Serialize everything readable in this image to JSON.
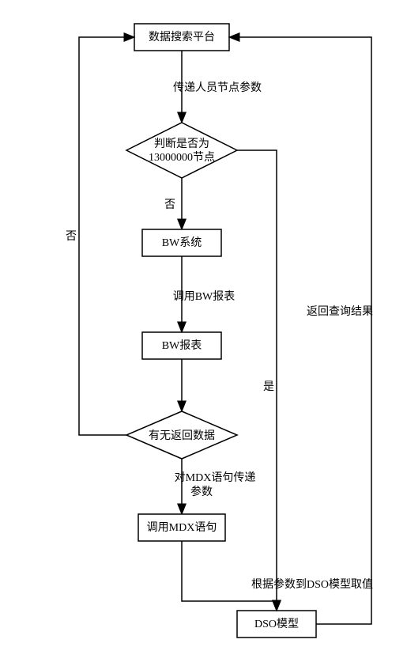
{
  "chart_data": {
    "type": "flowchart",
    "nodes": [
      {
        "id": "n1",
        "shape": "rect",
        "label": "数据搜索平台"
      },
      {
        "id": "n2",
        "shape": "diamond",
        "label_line1": "判断是否为",
        "label_line2": "13000000节点"
      },
      {
        "id": "n3",
        "shape": "rect",
        "label": "BW系统"
      },
      {
        "id": "n4",
        "shape": "rect",
        "label": "BW报表"
      },
      {
        "id": "n5",
        "shape": "diamond",
        "label": "有无返回数据"
      },
      {
        "id": "n6",
        "shape": "rect",
        "label": "调用MDX语句"
      },
      {
        "id": "n7",
        "shape": "rect",
        "label": "DSO模型"
      }
    ],
    "edges": [
      {
        "from": "n1",
        "to": "n2",
        "label": "传递人员节点参数"
      },
      {
        "from": "n2",
        "to": "n3",
        "label": "否"
      },
      {
        "from": "n3",
        "to": "n4",
        "label": "调用BW报表"
      },
      {
        "from": "n4",
        "to": "n5",
        "label": ""
      },
      {
        "from": "n5",
        "to": "n6",
        "label_line1": "对MDX语句传递",
        "label_line2": "参数"
      },
      {
        "from": "n6",
        "to": "n7",
        "label": "根据参数到DSO模型取值"
      },
      {
        "from": "n2",
        "to": "n7",
        "label": "是"
      },
      {
        "from": "n5",
        "to": "n1",
        "label": "否"
      },
      {
        "from": "n7",
        "to": "n1",
        "label": "返回查询结果"
      }
    ]
  },
  "labels": {
    "n1": "数据搜索平台",
    "n2_l1": "判断是否为",
    "n2_l2": "13000000节点",
    "n3": "BW系统",
    "n4": "BW报表",
    "n5": "有无返回数据",
    "n6": "调用MDX语句",
    "n7": "DSO模型",
    "e1": "传递人员节点参数",
    "e2": "否",
    "e3": "调用BW报表",
    "e5_l1": "对MDX语句传递",
    "e5_l2": "参数",
    "e6": "根据参数到DSO模型取值",
    "e7": "是",
    "e8": "否",
    "e9": "返回查询结果"
  }
}
